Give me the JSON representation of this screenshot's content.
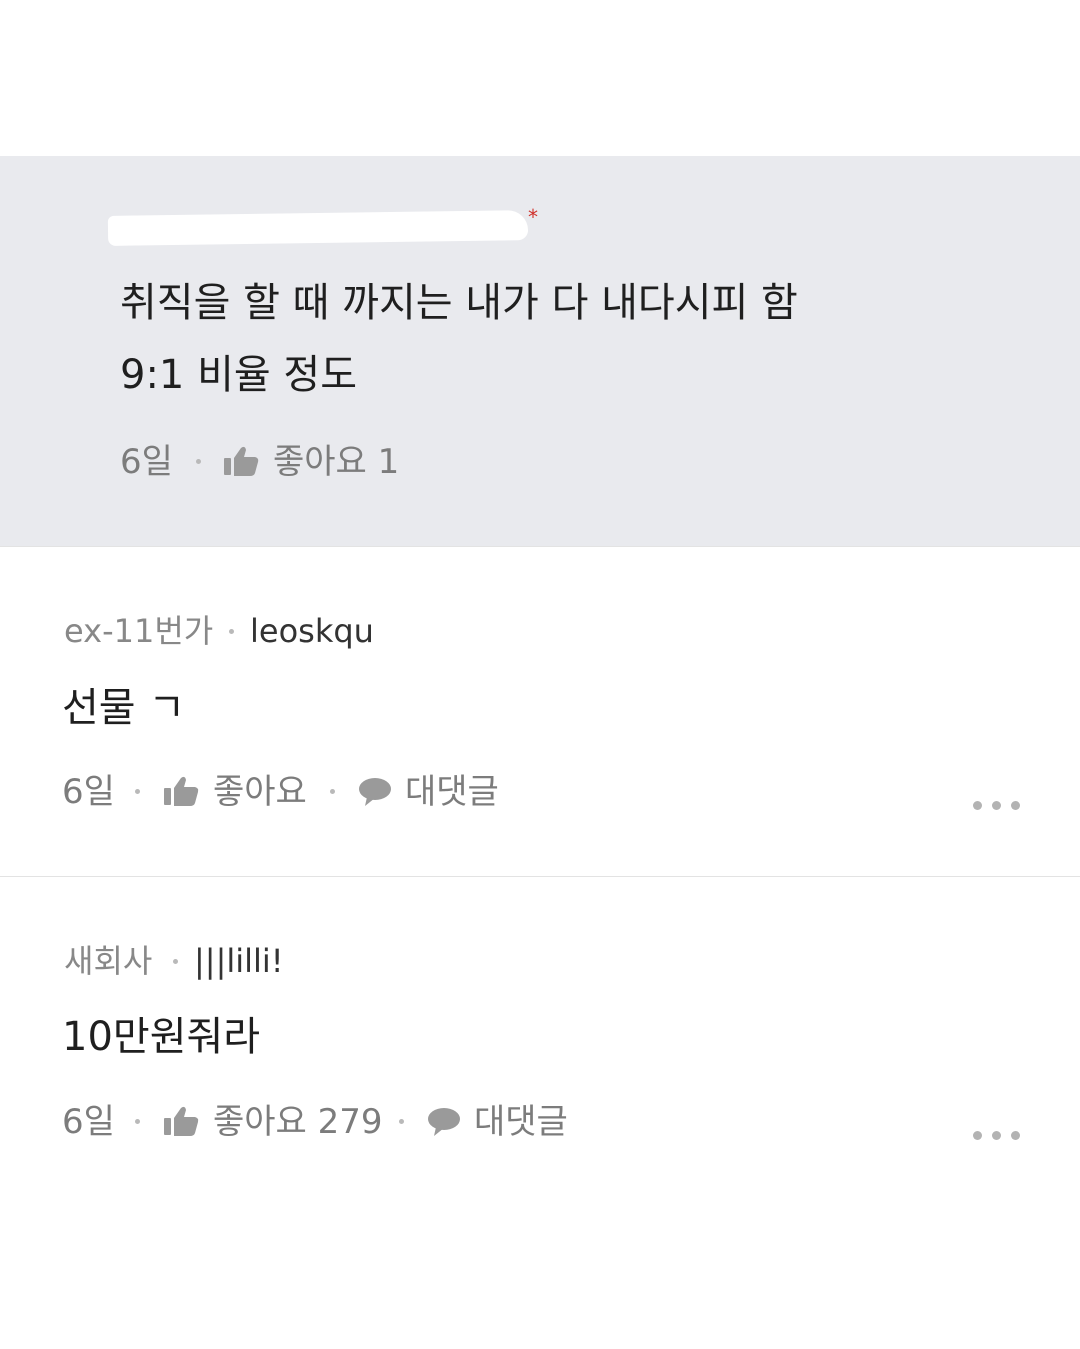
{
  "reply": {
    "line1": "취직을 할 때 까지는 내가 다 내다시피 함",
    "line2": "9:1 비율 정도",
    "time": "6일",
    "like_label": "좋아요 1"
  },
  "comments": [
    {
      "author": "ex-11번가",
      "nickname": "leoskqu",
      "text": "선물 ㄱ",
      "time": "6일",
      "like_label": "좋아요",
      "reply_label": "대댓글"
    },
    {
      "author": "새회사",
      "nickname": "|||lilli!",
      "text": "10만원줘라",
      "time": "6일",
      "like_label": "좋아요 279",
      "reply_label": "대댓글"
    }
  ],
  "icons": {
    "like": "thumbs-up-icon",
    "reply": "speech-bubble-icon",
    "more": "more-options-icon"
  },
  "colors": {
    "reply_background": "#e9eaee",
    "meta_text": "#7c7c7c",
    "redaction_mark": "#d0302a"
  }
}
